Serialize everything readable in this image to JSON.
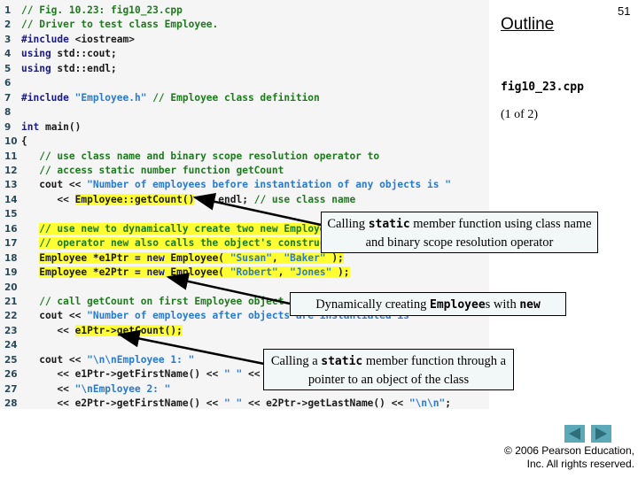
{
  "slide": {
    "page_number": "51",
    "outline_label": "Outline",
    "filename": "fig10_23.cpp",
    "page_of": "(1 of 2)",
    "copyright_line1": "© 2006 Pearson Education,",
    "copyright_line2": "Inc.  All rights reserved."
  },
  "nav": {
    "prev_icon": "triangle-left-icon",
    "next_icon": "triangle-right-icon",
    "color": "#5aa8b8"
  },
  "code": {
    "highlight_color": "#ffff33",
    "lines": [
      {
        "n": "1",
        "segs": [
          {
            "t": "// Fig. 10.23: fig10_23.cpp",
            "c": "cm"
          }
        ]
      },
      {
        "n": "2",
        "segs": [
          {
            "t": "// Driver to test class Employee.",
            "c": "cm"
          }
        ]
      },
      {
        "n": "3",
        "segs": [
          {
            "t": "#include ",
            "c": "kw"
          },
          {
            "t": "<iostream>",
            "c": "nm"
          }
        ]
      },
      {
        "n": "4",
        "segs": [
          {
            "t": "using ",
            "c": "kw"
          },
          {
            "t": "std::cout;",
            "c": "nm"
          }
        ]
      },
      {
        "n": "5",
        "segs": [
          {
            "t": "using ",
            "c": "kw"
          },
          {
            "t": "std::endl;",
            "c": "nm"
          }
        ]
      },
      {
        "n": "6",
        "segs": []
      },
      {
        "n": "7",
        "segs": [
          {
            "t": "#include ",
            "c": "kw"
          },
          {
            "t": "\"Employee.h\"",
            "c": "st"
          },
          {
            "t": " // Employee class definition",
            "c": "cm"
          }
        ]
      },
      {
        "n": "8",
        "segs": []
      },
      {
        "n": "9",
        "segs": [
          {
            "t": "int ",
            "c": "kw"
          },
          {
            "t": "main()",
            "c": "nm"
          }
        ]
      },
      {
        "n": "10",
        "segs": [
          {
            "t": "{",
            "c": "nm"
          }
        ]
      },
      {
        "n": "11",
        "segs": [
          {
            "t": "   // use class name and binary scope resolution operator to",
            "c": "cm"
          }
        ]
      },
      {
        "n": "12",
        "segs": [
          {
            "t": "   // access static number function getCount",
            "c": "cm"
          }
        ]
      },
      {
        "n": "13",
        "segs": [
          {
            "t": "   cout << ",
            "c": "nm"
          },
          {
            "t": "\"Number of employees before instantiation of any objects is \"",
            "c": "st"
          }
        ]
      },
      {
        "n": "14",
        "segs": [
          {
            "t": "      << ",
            "c": "nm"
          },
          {
            "t": "Employee::getCount()",
            "c": "nm",
            "hl": true
          },
          {
            "t": " << endl; ",
            "c": "nm"
          },
          {
            "t": "// use class name",
            "c": "cm"
          }
        ]
      },
      {
        "n": "15",
        "segs": []
      },
      {
        "n": "16",
        "segs": [
          {
            "t": "   ",
            "c": "nm"
          },
          {
            "t": "// use new to dynamically create two new Employees",
            "c": "cm",
            "hl": true
          }
        ]
      },
      {
        "n": "17",
        "segs": [
          {
            "t": "   ",
            "c": "nm"
          },
          {
            "t": "// operator new also calls the object's constructor",
            "c": "cm",
            "hl": true
          }
        ]
      },
      {
        "n": "18",
        "segs": [
          {
            "t": "   ",
            "c": "nm"
          },
          {
            "t": "Employee *e1Ptr = ",
            "c": "nm",
            "hl": true
          },
          {
            "t": "new ",
            "c": "kw",
            "hl": true
          },
          {
            "t": "Employee( ",
            "c": "nm",
            "hl": true
          },
          {
            "t": "\"Susan\"",
            "c": "st",
            "hl": true
          },
          {
            "t": ", ",
            "c": "nm",
            "hl": true
          },
          {
            "t": "\"Baker\"",
            "c": "st",
            "hl": true
          },
          {
            "t": " );",
            "c": "nm",
            "hl": true
          }
        ]
      },
      {
        "n": "19",
        "segs": [
          {
            "t": "   ",
            "c": "nm"
          },
          {
            "t": "Employee *e2Ptr = ",
            "c": "nm",
            "hl": true
          },
          {
            "t": "new ",
            "c": "kw",
            "hl": true
          },
          {
            "t": "Employee( ",
            "c": "nm",
            "hl": true
          },
          {
            "t": "\"Robert\"",
            "c": "st",
            "hl": true
          },
          {
            "t": ", ",
            "c": "nm",
            "hl": true
          },
          {
            "t": "\"Jones\"",
            "c": "st",
            "hl": true
          },
          {
            "t": " );",
            "c": "nm",
            "hl": true
          }
        ]
      },
      {
        "n": "20",
        "segs": []
      },
      {
        "n": "21",
        "segs": [
          {
            "t": "   // call getCount on first Employee object",
            "c": "cm"
          }
        ]
      },
      {
        "n": "22",
        "segs": [
          {
            "t": "   cout << ",
            "c": "nm"
          },
          {
            "t": "\"Number of employees after objects are instantiated is \"",
            "c": "st"
          }
        ]
      },
      {
        "n": "23",
        "segs": [
          {
            "t": "      << ",
            "c": "nm"
          },
          {
            "t": "e1Ptr->getCount();",
            "c": "nm",
            "hl": true
          }
        ]
      },
      {
        "n": "24",
        "segs": []
      },
      {
        "n": "25",
        "segs": [
          {
            "t": "   cout << ",
            "c": "nm"
          },
          {
            "t": "\"\\n\\nEmployee 1: \"",
            "c": "st"
          }
        ]
      },
      {
        "n": "26",
        "segs": [
          {
            "t": "      << e1Ptr->getFirstName() << ",
            "c": "nm"
          },
          {
            "t": "\" \"",
            "c": "st"
          },
          {
            "t": " << e1Ptr->getLastName()",
            "c": "nm"
          }
        ]
      },
      {
        "n": "27",
        "segs": [
          {
            "t": "      << ",
            "c": "nm"
          },
          {
            "t": "\"\\nEmployee 2: \"",
            "c": "st"
          }
        ]
      },
      {
        "n": "28",
        "segs": [
          {
            "t": "      << e2Ptr->getFirstName() << ",
            "c": "nm"
          },
          {
            "t": "\" \"",
            "c": "st"
          },
          {
            "t": " << e2Ptr->getLastName() << ",
            "c": "nm"
          },
          {
            "t": "\"\\n\\n\"",
            "c": "st"
          },
          {
            "t": ";",
            "c": "nm"
          }
        ]
      }
    ]
  },
  "callouts": {
    "c1": {
      "pre": "Calling ",
      "mono": "static",
      "post": " member function using class name and binary scope resolution operator"
    },
    "c2": {
      "pre": "Dynamically creating ",
      "mono": "Employee",
      "post_after_mono": "s with ",
      "mono2": "new"
    },
    "c3": {
      "pre": "Calling a ",
      "mono": "static",
      "post": " member function through a pointer to an object of the class"
    }
  }
}
